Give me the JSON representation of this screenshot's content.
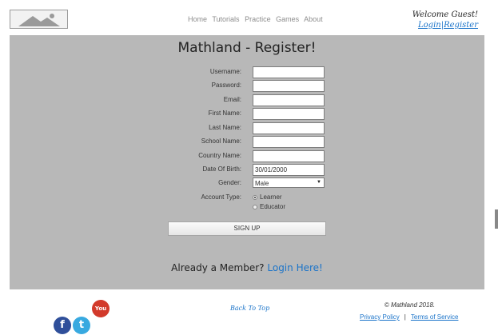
{
  "header": {
    "nav": [
      "Home",
      "Tutorials",
      "Practice",
      "Games",
      "About"
    ],
    "welcome": "Welcome Guest!",
    "login": "Login",
    "sep": "|",
    "register": "Register"
  },
  "form": {
    "title": "Mathland - Register!",
    "fields": [
      {
        "label": "Username:",
        "value": ""
      },
      {
        "label": "Password:",
        "value": ""
      },
      {
        "label": "Email:",
        "value": ""
      },
      {
        "label": "First Name:",
        "value": ""
      },
      {
        "label": "Last Name:",
        "value": ""
      },
      {
        "label": "School Name:",
        "value": ""
      },
      {
        "label": "Country Name:",
        "value": ""
      },
      {
        "label": "Date Of Birth:",
        "value": "30/01/2000"
      }
    ],
    "gender_label": "Gender:",
    "gender_value": "Male",
    "account_label": "Account Type:",
    "account_options": [
      "Learner",
      "Educator"
    ],
    "account_selected": "Learner",
    "signup": "SIGN UP",
    "member_text": "Already a Member?",
    "member_link": "Login Here!"
  },
  "footer": {
    "social": [
      "facebook-icon",
      "twitter-icon",
      "youtube-icon"
    ],
    "facebook_glyph": "f",
    "twitter_glyph": "t",
    "youtube_glyph": "You Tube",
    "back_to_top": "Back To Top",
    "copyright": "© Mathland 2018.",
    "privacy": "Privacy Policy",
    "bar": "|",
    "terms": "Terms of Service"
  },
  "colors": {
    "panel": "#b8b8b8",
    "link": "#1a73c9"
  }
}
